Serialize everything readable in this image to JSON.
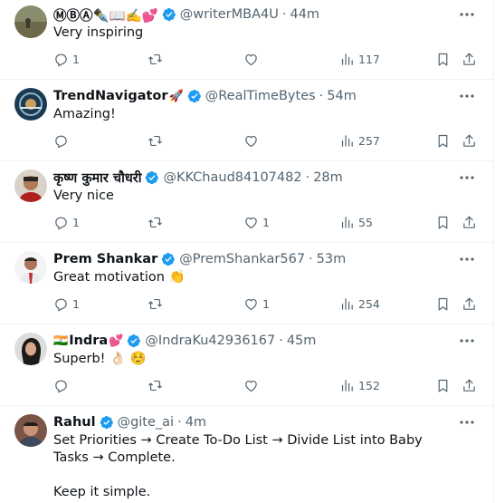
{
  "replies": [
    {
      "display_name": "ⓂⒷⒶ✒️📖✍️💕",
      "handle": "@writerMBA4U",
      "time": "44m",
      "text": "Very inspiring",
      "reply_count": "1",
      "retweet_count": "",
      "like_count": "",
      "view_count": "117"
    },
    {
      "display_name": "TrendNavigator",
      "name_emoji": "🚀",
      "handle": "@RealTimeBytes",
      "time": "54m",
      "text": "Amazing!",
      "reply_count": "",
      "retweet_count": "",
      "like_count": "",
      "view_count": "257"
    },
    {
      "display_name": "कृष्ण कुमार चौधरी",
      "handle": "@KKChaud84107482",
      "time": "28m",
      "text": "Very nice",
      "reply_count": "1",
      "retweet_count": "",
      "like_count": "1",
      "view_count": "55"
    },
    {
      "display_name": "Prem Shankar",
      "handle": "@PremShankar567",
      "time": "53m",
      "text": "Great motivation 👏",
      "reply_count": "1",
      "retweet_count": "",
      "like_count": "1",
      "view_count": "254"
    },
    {
      "name_prefix_emoji": "🇮🇳",
      "display_name": "Indra",
      "name_emoji": "💕",
      "handle": "@IndraKu42936167",
      "time": "45m",
      "text": "Superb! 👌🏻 ☺️",
      "reply_count": "",
      "retweet_count": "",
      "like_count": "",
      "view_count": "152"
    },
    {
      "display_name": "Rahul",
      "handle": "@gite_ai",
      "time": "4m",
      "text": "Set Priorities → Create To-Do List → Divide List into Baby Tasks → Complete.\n\nKeep it simple."
    }
  ],
  "colors": {
    "verified": "#1d9bf0",
    "secondary_text": "#536471",
    "divider": "#eff3f4"
  },
  "icons": {
    "reply": "reply-icon",
    "retweet": "retweet-icon",
    "like": "heart-icon",
    "views": "views-chart-icon",
    "bookmark": "bookmark-icon",
    "share": "share-icon",
    "more": "more-dots-icon",
    "verified": "verified-badge-icon"
  }
}
